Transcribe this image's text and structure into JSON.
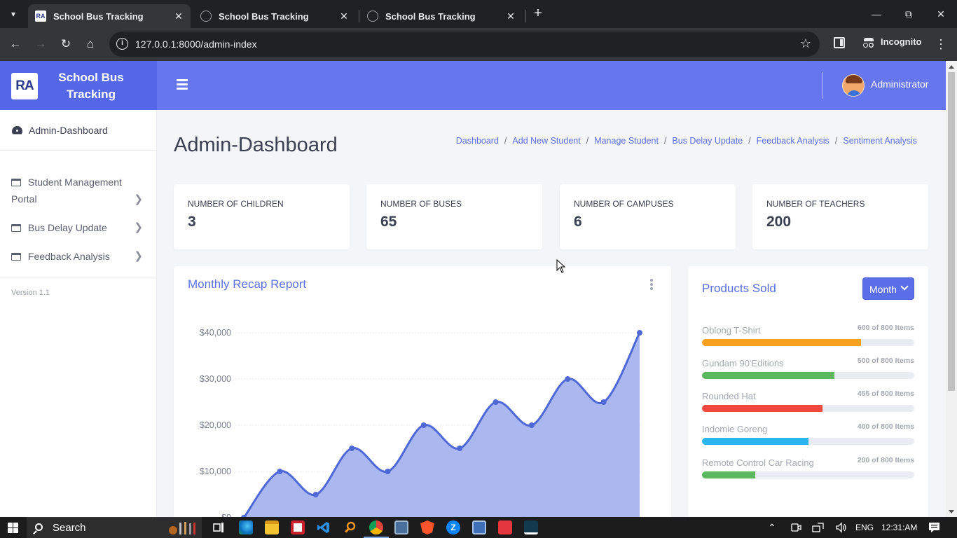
{
  "browser": {
    "tabs": [
      {
        "title": "School Bus Tracking",
        "active": true,
        "favicon": "ra-logo-icon"
      },
      {
        "title": "School Bus Tracking",
        "active": false,
        "favicon": "globe-icon"
      },
      {
        "title": "School Bus Tracking",
        "active": false,
        "favicon": "globe-icon"
      }
    ],
    "url": "127.0.0.1:8000/admin-index",
    "profile_label": "Incognito"
  },
  "brand": {
    "logo_text": "RA",
    "name": "School Bus Tracking"
  },
  "sidebar": {
    "active_item": "Admin-Dashboard",
    "items": [
      {
        "label": "Student Management Portal"
      },
      {
        "label": "Bus Delay Update"
      },
      {
        "label": "Feedback Analysis"
      }
    ],
    "version": "Version 1.1"
  },
  "topnav": {
    "user_name": "Administrator"
  },
  "page": {
    "title": "Admin-Dashboard",
    "breadcrumb": [
      "Dashboard",
      "Add New Student",
      "Manage Student",
      "Bus Delay Update",
      "Feedback Analysis",
      "Sentiment Analysis"
    ]
  },
  "stats": [
    {
      "label": "NUMBER OF CHILDREN",
      "value": "3"
    },
    {
      "label": "NUMBER OF BUSES",
      "value": "65"
    },
    {
      "label": "NUMBER OF CAMPUSES",
      "value": "6"
    },
    {
      "label": "NUMBER OF TEACHERS",
      "value": "200"
    }
  ],
  "recap": {
    "title": "Monthly Recap Report"
  },
  "chart_data": {
    "type": "area",
    "title": "Monthly Recap Report",
    "xlabel": "",
    "ylabel": "",
    "y_tick_labels": [
      "$0",
      "$10,000",
      "$20,000",
      "$30,000",
      "$40,000"
    ],
    "y_ticks": [
      0,
      10000,
      20000,
      30000,
      40000
    ],
    "ylim": [
      0,
      40000
    ],
    "grid": true,
    "series": [
      {
        "values": [
          0,
          10000,
          5000,
          15000,
          10000,
          20000,
          15000,
          25000,
          20000,
          30000,
          25000,
          40000
        ]
      }
    ],
    "colors": {
      "line": "#4e68d8",
      "fill": "#a5b4ee"
    }
  },
  "products": {
    "title": "Products Sold",
    "filter_label": "Month",
    "items": [
      {
        "name": "Oblong T-Shirt",
        "count_text": "600 of 800 Items",
        "value": 600,
        "max": 800,
        "color": "#f6a21e"
      },
      {
        "name": "Gundam 90'Editions",
        "count_text": "500 of 800 Items",
        "value": 500,
        "max": 800,
        "color": "#5cb85c"
      },
      {
        "name": "Rounded Hat",
        "count_text": "455 of 800 Items",
        "value": 455,
        "max": 800,
        "color": "#f0483e"
      },
      {
        "name": "Indomie Goreng",
        "count_text": "400 of 800 Items",
        "value": 400,
        "max": 800,
        "color": "#2cb6ee"
      },
      {
        "name": "Remote Control Car Racing",
        "count_text": "200 of 800 Items",
        "value": 200,
        "max": 800,
        "color": "#5cb85c"
      }
    ]
  },
  "taskbar": {
    "search_label": "Search",
    "language": "ENG",
    "time": "12:31:AM"
  }
}
